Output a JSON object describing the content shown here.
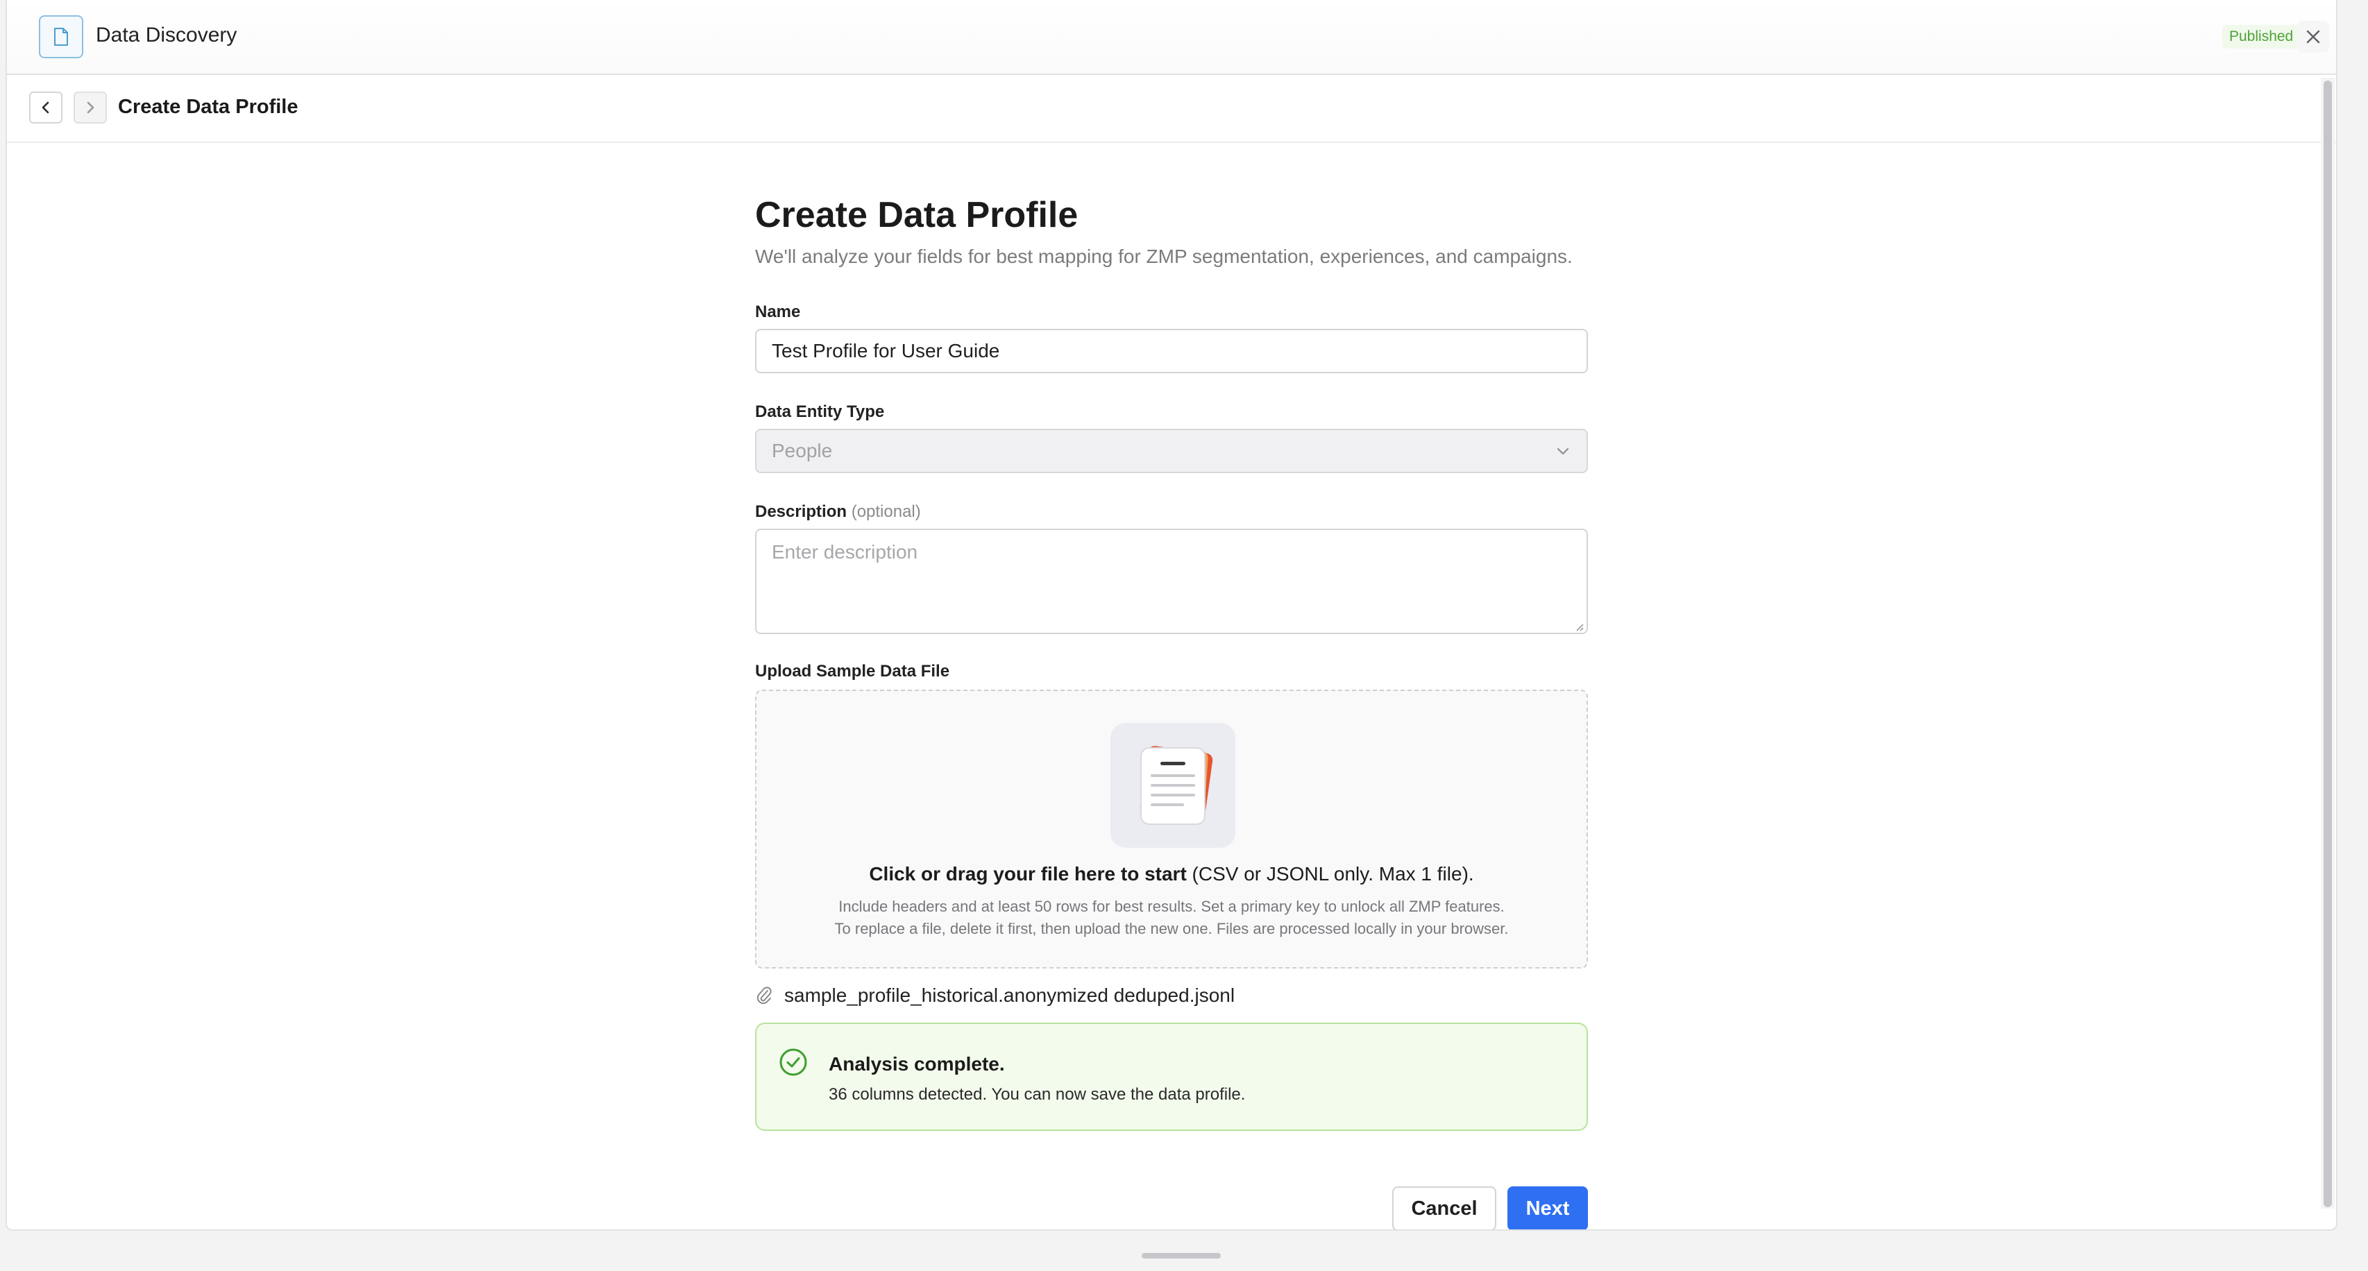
{
  "titlebar": {
    "app_title": "Data Discovery",
    "status_badge": "Published",
    "accent_color": "#2f6ff2",
    "success_color": "#4fa337"
  },
  "navbar": {
    "title": "Create Data Profile"
  },
  "form": {
    "heading": "Create Data Profile",
    "subtitle": "We'll analyze your fields for best mapping for ZMP segmentation, experiences, and campaigns.",
    "name": {
      "label": "Name",
      "value": "Test Profile for User Guide"
    },
    "entity_type": {
      "label": "Data Entity Type",
      "value": "People"
    },
    "description": {
      "label": "Description",
      "optional": "(optional)",
      "placeholder": "Enter description"
    },
    "upload": {
      "label": "Upload Sample Data File",
      "cta_bold": "Click or drag your file here to start",
      "cta_rest": " (CSV or JSONL only. Max 1 file).",
      "hint_line1": "Include headers and at least 50 rows for best results. Set a primary key to unlock all ZMP features.",
      "hint_line2": "To replace a file, delete it first, then upload the new one. Files are processed locally in your browser."
    },
    "uploaded_file": "sample_profile_historical.anonymized deduped.jsonl",
    "analysis": {
      "title": "Analysis complete.",
      "message": "36 columns detected. You can now save the data profile."
    },
    "actions": {
      "cancel": "Cancel",
      "next": "Next"
    }
  }
}
